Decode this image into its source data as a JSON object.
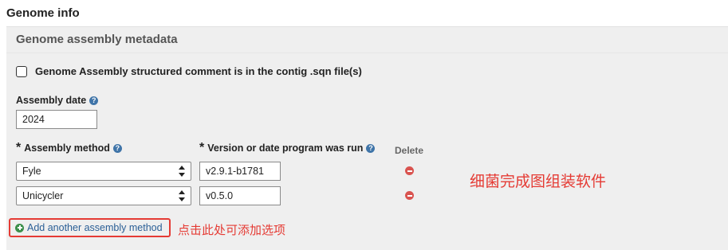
{
  "section": {
    "title": "Genome info"
  },
  "panel": {
    "title": "Genome assembly metadata"
  },
  "structured_comment": {
    "label": "Genome Assembly structured comment is in the contig .sqn file(s)",
    "checked": false
  },
  "assembly_date": {
    "label": "Assembly date",
    "value": "2024"
  },
  "columns": {
    "method": "Assembly method",
    "version": "Version or date program was run",
    "delete": "Delete"
  },
  "rows": [
    {
      "method": "Fyle",
      "version": "v2.9.1-b1781"
    },
    {
      "method": "Unicycler",
      "version": "v0.5.0"
    }
  ],
  "add_method_label": "Add another assembly method",
  "annotations": {
    "software_note": "细菌完成图组装软件",
    "click_note": "点击此处可添加选项"
  },
  "colors": {
    "accent_link": "#2a5f96",
    "annotation_red": "#e53b34",
    "delete_red": "#d9534f",
    "help_blue": "#3f74a8",
    "add_green": "#3b8f4a"
  },
  "icons": [
    "help-icon",
    "select-arrows-icon",
    "minus-circle-icon",
    "plus-circle-icon",
    "required-asterisk-icon"
  ]
}
